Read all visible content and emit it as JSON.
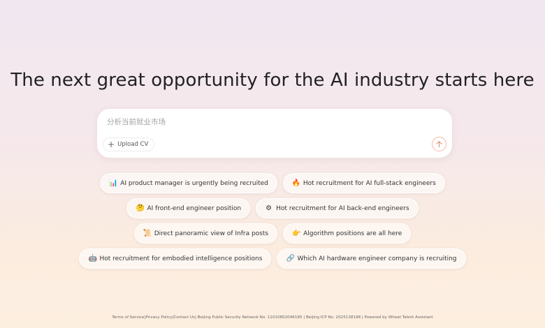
{
  "hero": {
    "title": "The next great opportunity for the AI industry starts here"
  },
  "search": {
    "placeholder": "分析当前就业市场",
    "value": "",
    "upload_label": "Upload CV",
    "upload_icon": "plus-icon",
    "send_icon": "arrow-up-icon"
  },
  "suggestions": [
    {
      "icon": "📊",
      "icon_name": "bar-chart-icon",
      "label": "AI product manager is urgently being recruited"
    },
    {
      "icon": "🔥",
      "icon_name": "fire-icon",
      "label": "Hot recruitment for AI full-stack engineers"
    },
    {
      "icon": "🤔",
      "icon_name": "thinking-face-icon",
      "label": "AI front-end engineer position"
    },
    {
      "icon": "⚙",
      "icon_name": "gear-icon",
      "label": "Hot recruitment for AI back-end engineers"
    },
    {
      "icon": "📜",
      "icon_name": "scroll-icon",
      "label": "Direct panoramic view of Infra posts"
    },
    {
      "icon": "👉",
      "icon_name": "pointing-hand-icon",
      "label": "Algorithm positions are all here"
    },
    {
      "icon": "🤖",
      "icon_name": "robot-icon",
      "label": "Hot recruitment for embodied intelligence positions"
    },
    {
      "icon": "🔗",
      "icon_name": "link-icon",
      "label": "Which AI hardware engineer company is recruiting"
    }
  ],
  "footer": {
    "terms": "Terms of Service",
    "privacy": "|Privacy Policy|",
    "contact": "Contact Us",
    "info": "| Beijing Public Security Network No. 11010802046185 | Beijing ICP No. 2025138198 | Powered by Wheat Talent Assistant"
  },
  "colors": {
    "accent": "#f1b9a6",
    "send_arrow": "#e2947a"
  }
}
